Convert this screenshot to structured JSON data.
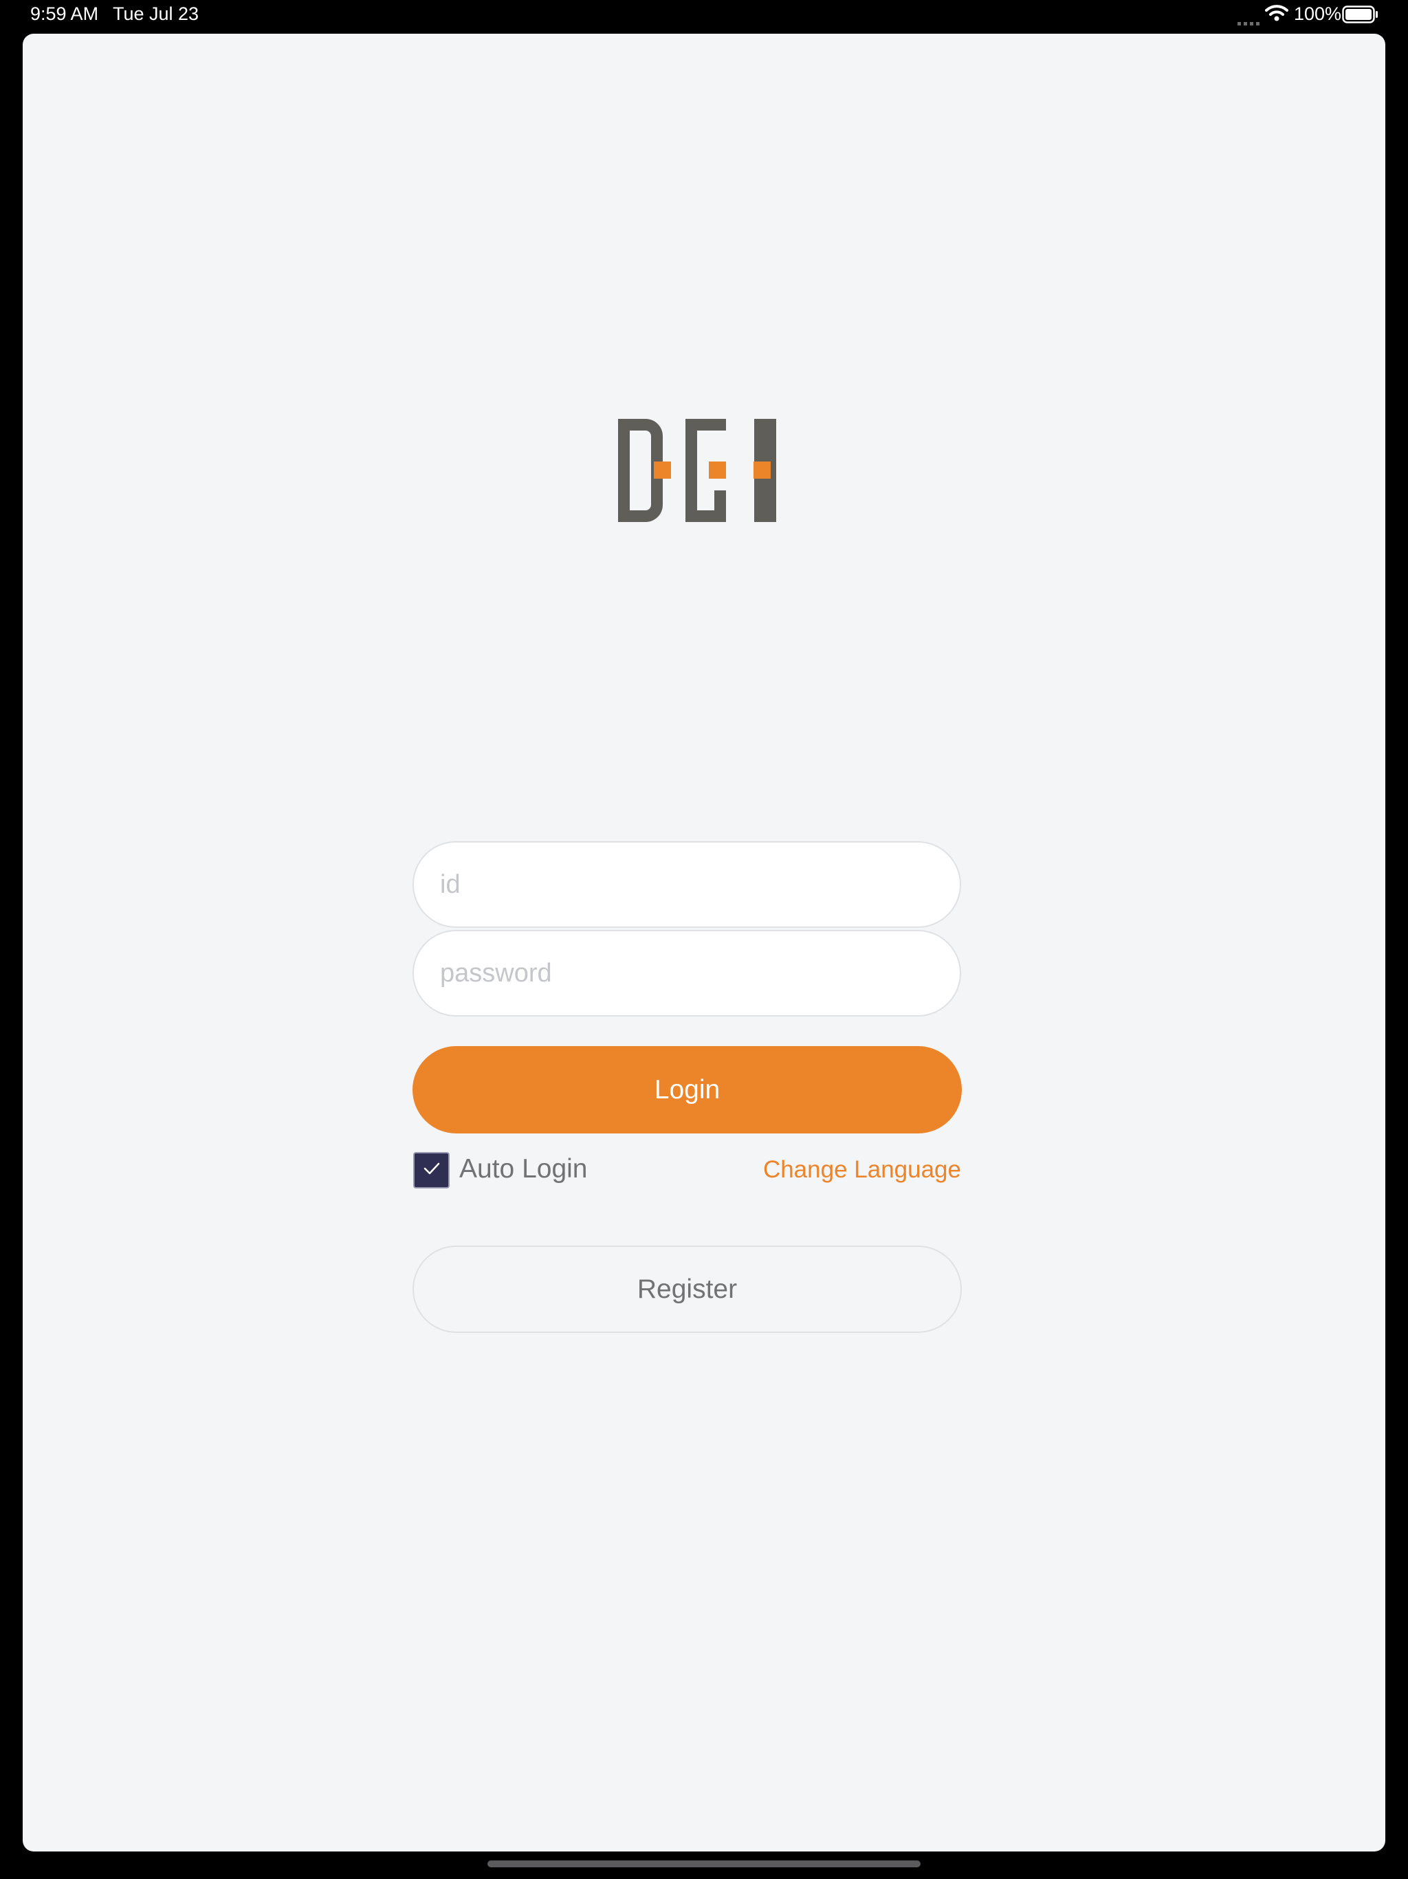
{
  "status_bar": {
    "time": "9:59 AM",
    "date": "Tue Jul 23",
    "battery_percent": "100%",
    "icons": [
      "cellular-signal-icon",
      "wifi-icon",
      "battery-icon"
    ]
  },
  "logo": {
    "text": "DGI",
    "icon": "dgi-logo-icon"
  },
  "form": {
    "id_placeholder": "id",
    "id_value": "",
    "password_placeholder": "password",
    "password_value": "",
    "login_label": "Login",
    "auto_login_label": "Auto Login",
    "auto_login_checked": true,
    "change_language_label": "Change Language",
    "register_label": "Register"
  },
  "colors": {
    "accent": "#ec8429",
    "logo_gray": "#5f5e58",
    "checkbox_fill": "#2e2f52",
    "background": "#f4f5f7",
    "muted_text": "#707275"
  }
}
